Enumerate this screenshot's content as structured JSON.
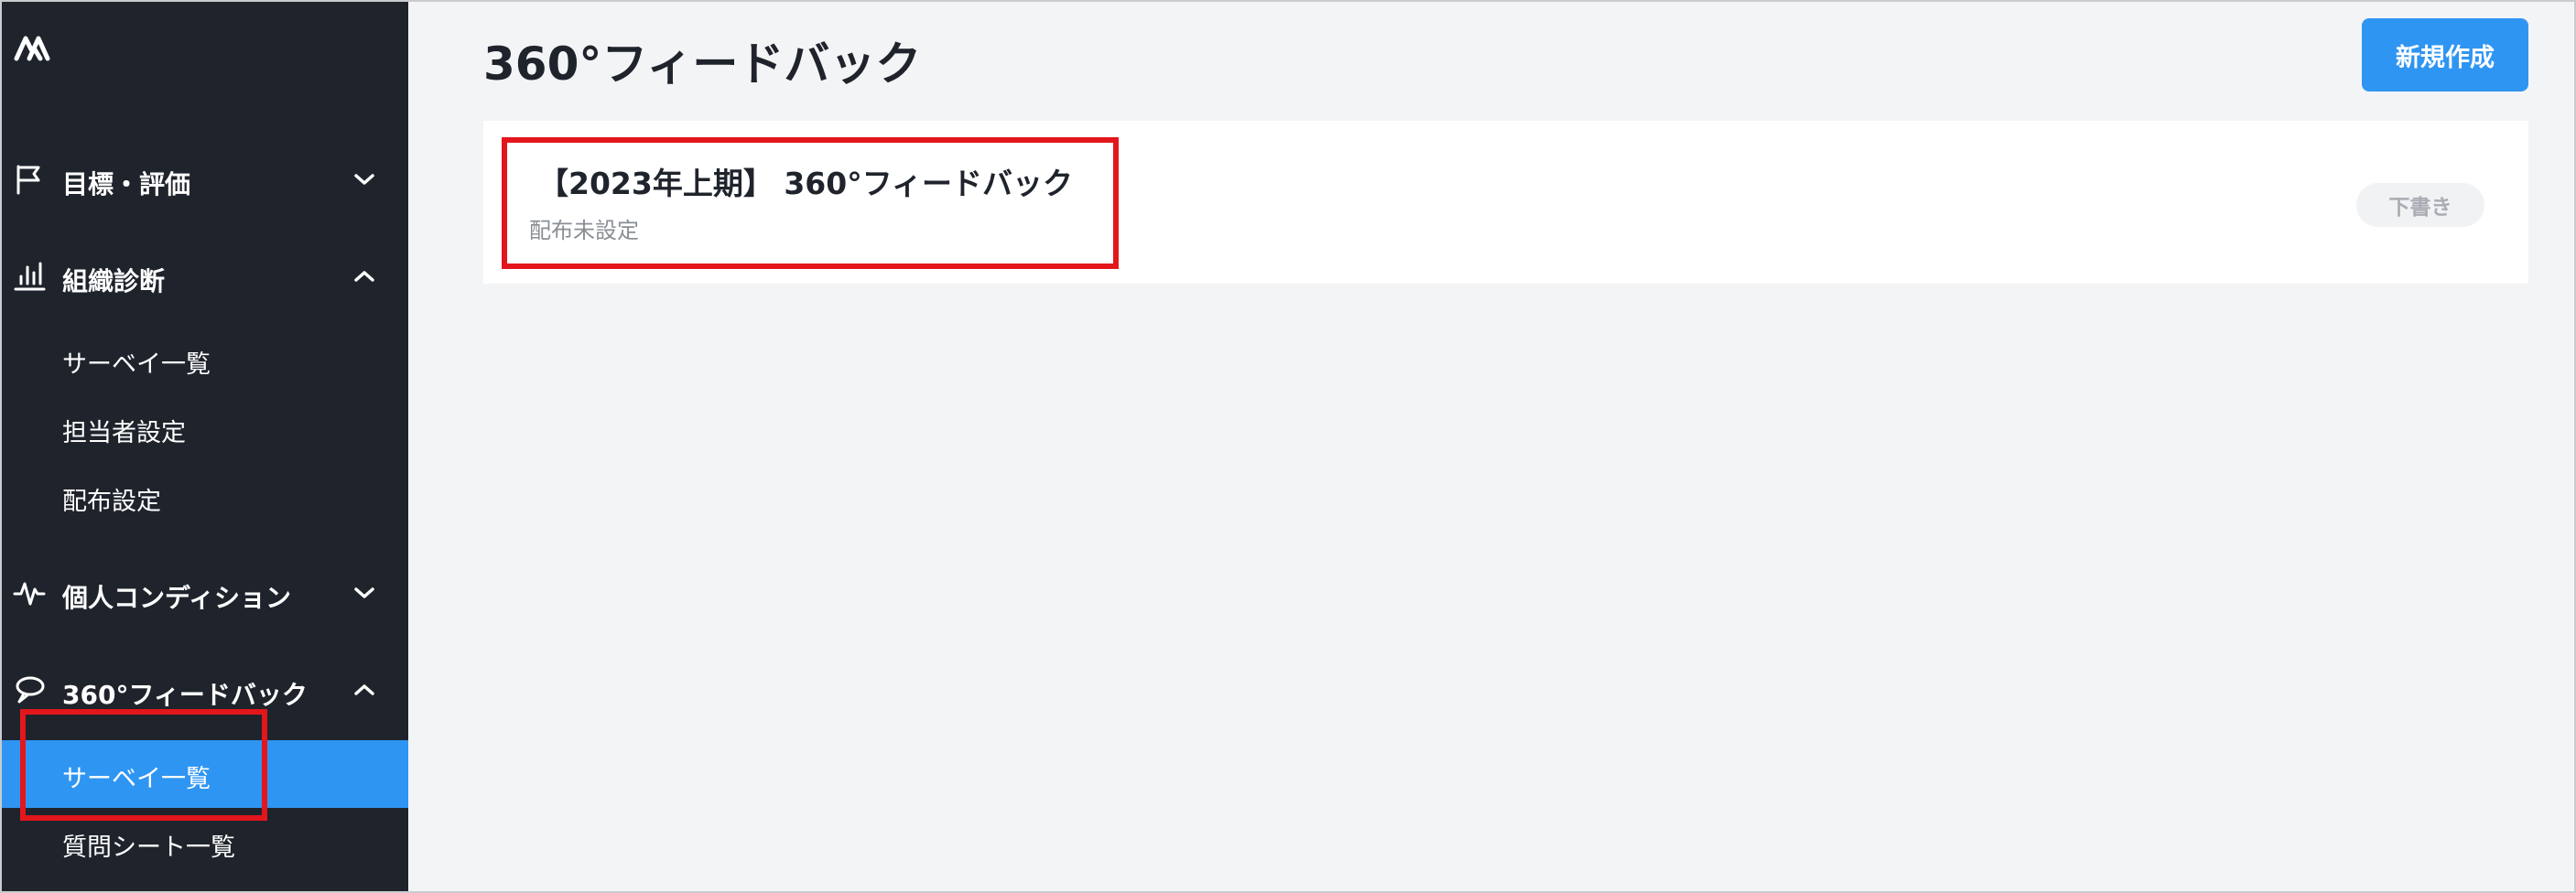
{
  "sidebar": {
    "logo_icon": "company-logo-icon",
    "groups": [
      {
        "label": "目標・評価",
        "icon": "flag-icon",
        "expanded": false
      },
      {
        "label": "組織診断",
        "icon": "bar-chart-icon",
        "expanded": true,
        "items": [
          {
            "label": "サーベイ一覧"
          },
          {
            "label": "担当者設定"
          },
          {
            "label": "配布設定"
          }
        ]
      },
      {
        "label": "個人コンディション",
        "icon": "pulse-icon",
        "expanded": false
      },
      {
        "label": "360°フィードバック",
        "icon": "speech-bubble-icon",
        "expanded": true,
        "items": [
          {
            "label": "サーベイ一覧",
            "active": true
          },
          {
            "label": "質問シート一覧"
          }
        ]
      }
    ]
  },
  "main": {
    "title": "360°フィードバック",
    "new_button_label": "新規作成",
    "surveys": [
      {
        "title": "【2023年上期】 360°フィードバック",
        "subtitle": "配布未設定",
        "status": "下書き"
      }
    ]
  },
  "colors": {
    "sidebar_bg": "#1f242c",
    "accent": "#2f95f2",
    "highlight": "#e3161c",
    "page_bg": "#f3f4f6"
  }
}
